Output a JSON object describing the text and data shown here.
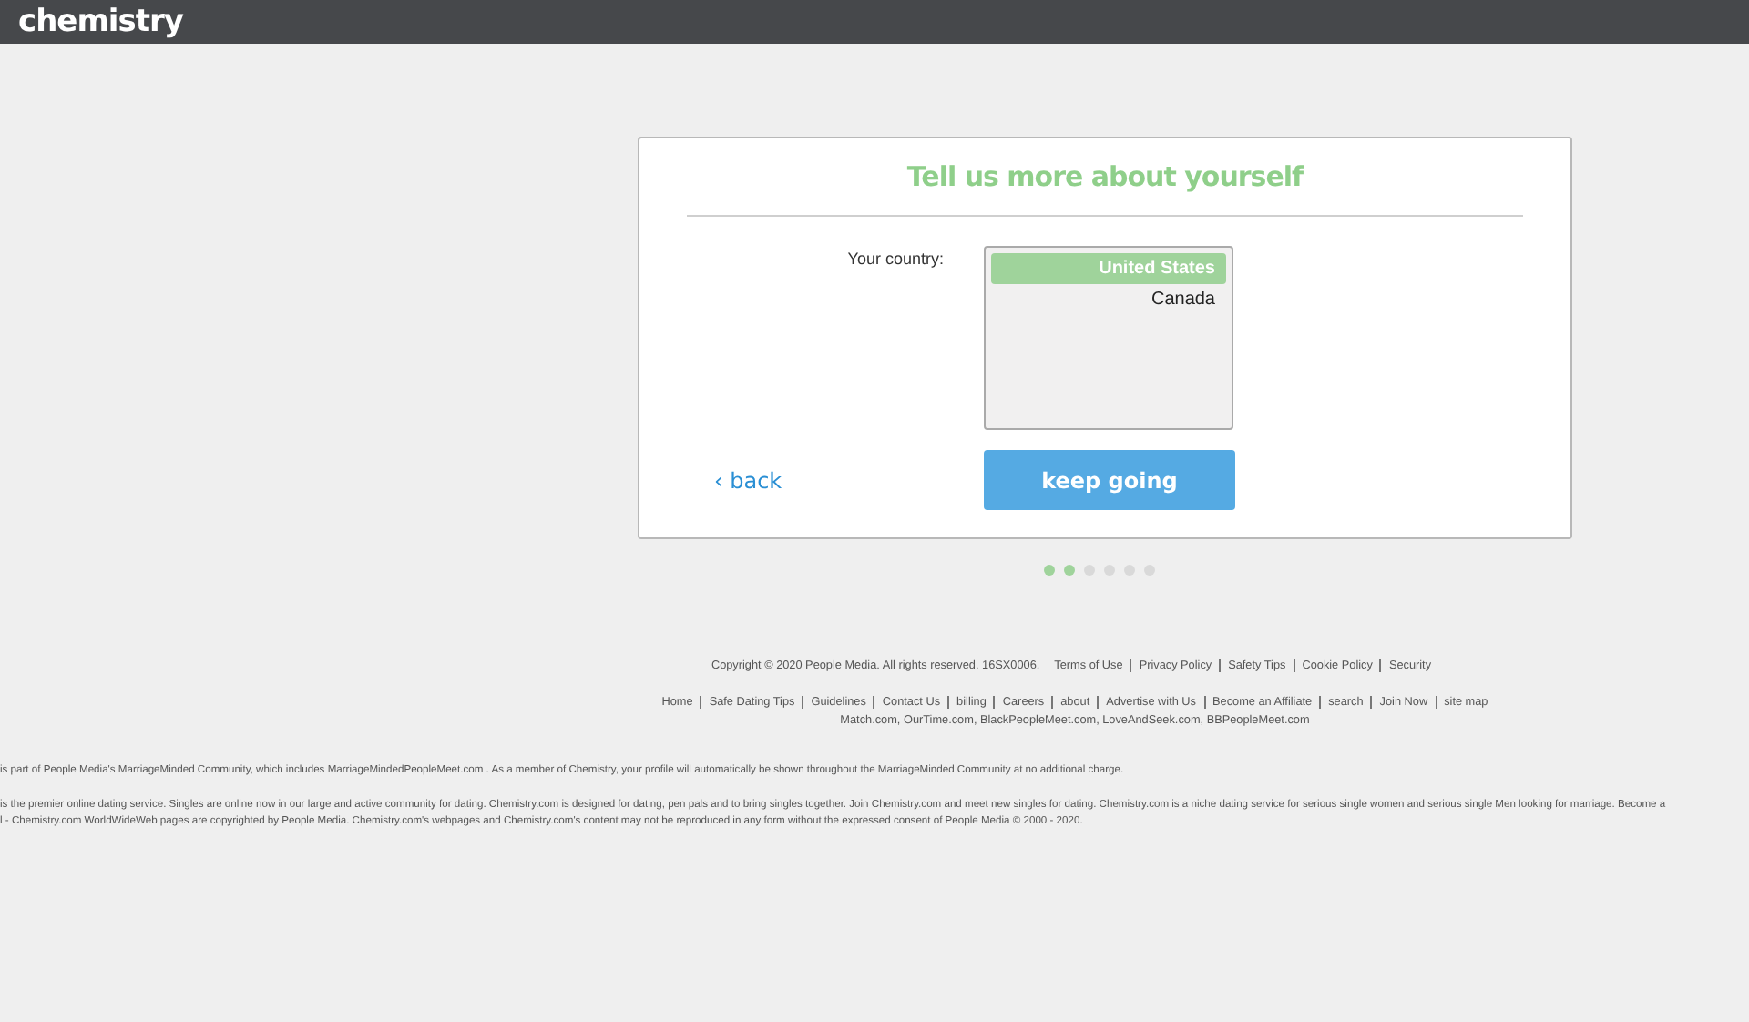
{
  "header": {
    "logo": "chemistry"
  },
  "form": {
    "title": "Tell us more about yourself",
    "field_label": "Your country:",
    "options": [
      {
        "label": "United States",
        "selected": true
      },
      {
        "label": "Canada",
        "selected": false
      }
    ],
    "back_link": "‹ back",
    "submit_button": "keep going"
  },
  "progress_steps": [
    {
      "done": true
    },
    {
      "done": true
    },
    {
      "done": false
    },
    {
      "done": false
    },
    {
      "done": false
    },
    {
      "done": false
    }
  ],
  "footer": {
    "copyright": "Copyright © 2020 People Media. All rights reserved. 16SX0006.",
    "legal_links": [
      "Terms of Use",
      "Privacy Policy",
      "Safety Tips",
      "Cookie Policy",
      "Security"
    ],
    "nav_links": [
      "Home",
      "Safe Dating Tips",
      "Guidelines",
      "Contact Us",
      "billing",
      "Careers",
      "about",
      "Advertise with Us",
      "Become an Affiliate",
      "search",
      "Join Now",
      "site map"
    ],
    "partner_sites": "Match.com, OurTime.com, BlackPeopleMeet.com, LoveAndSeek.com, BBPeopleMeet.com",
    "community_note": "is part of People Media's MarriageMinded Community, which includes MarriageMindedPeopleMeet.com . As a member of Chemistry, your profile will automatically be shown throughout the MarriageMinded Community at no additional charge.",
    "about_lines": [
      "is the premier online dating service. Singles are online now in our large and active community for dating. Chemistry.com is designed for dating, pen pals and to bring singles together. Join Chemistry.com and meet new singles for dating. Chemistry.com is a niche dating service for serious single women and serious single Men looking for marriage. Become a",
      "l - Chemistry.com WorldWideWeb pages are copyrighted by People Media. Chemistry.com's webpages and Chemistry.com's content may not be reproduced in any form without the expressed consent of People Media © 2000 - 2020."
    ]
  }
}
